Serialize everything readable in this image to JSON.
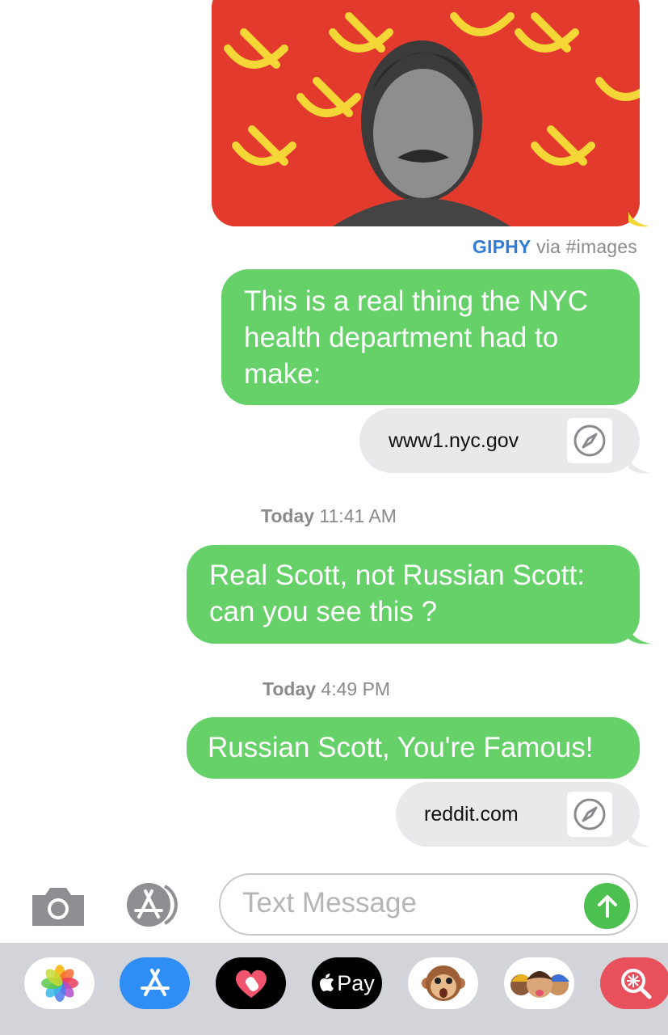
{
  "gif": {
    "source_brand": "GIPHY",
    "source_suffix": "via #images"
  },
  "messages": [
    {
      "type": "sent",
      "text": "This is a real thing the NYC health department had to make:"
    },
    {
      "type": "link",
      "domain": "www1.nyc.gov"
    },
    {
      "type": "timestamp",
      "day": "Today",
      "time": "11:41 AM"
    },
    {
      "type": "sent",
      "text": "Real Scott, not Russian Scott: can you see this ?"
    },
    {
      "type": "timestamp",
      "day": "Today",
      "time": "4:49 PM"
    },
    {
      "type": "sent",
      "text": "Russian Scott, You're Famous!"
    },
    {
      "type": "link",
      "domain": "reddit.com"
    }
  ],
  "composer": {
    "placeholder": "Text Message",
    "camera_icon": "camera-icon",
    "apps_icon": "app-store-icon",
    "send_icon": "arrow-up-icon"
  },
  "app_drawer": {
    "apps": [
      {
        "name": "photos-icon"
      },
      {
        "name": "app-store-icon"
      },
      {
        "name": "digital-touch-icon"
      },
      {
        "name": "apple-pay-icon",
        "label": "Pay"
      },
      {
        "name": "animoji-monkey-icon"
      },
      {
        "name": "memoji-icon"
      },
      {
        "name": "images-search-icon"
      }
    ]
  },
  "colors": {
    "sent_bubble": "#66d069",
    "link_bubble": "#e9e9eb",
    "send_button": "#4cc150",
    "giphy_brand": "#2f7bd6",
    "drawer_bg": "#d3d4d9"
  }
}
